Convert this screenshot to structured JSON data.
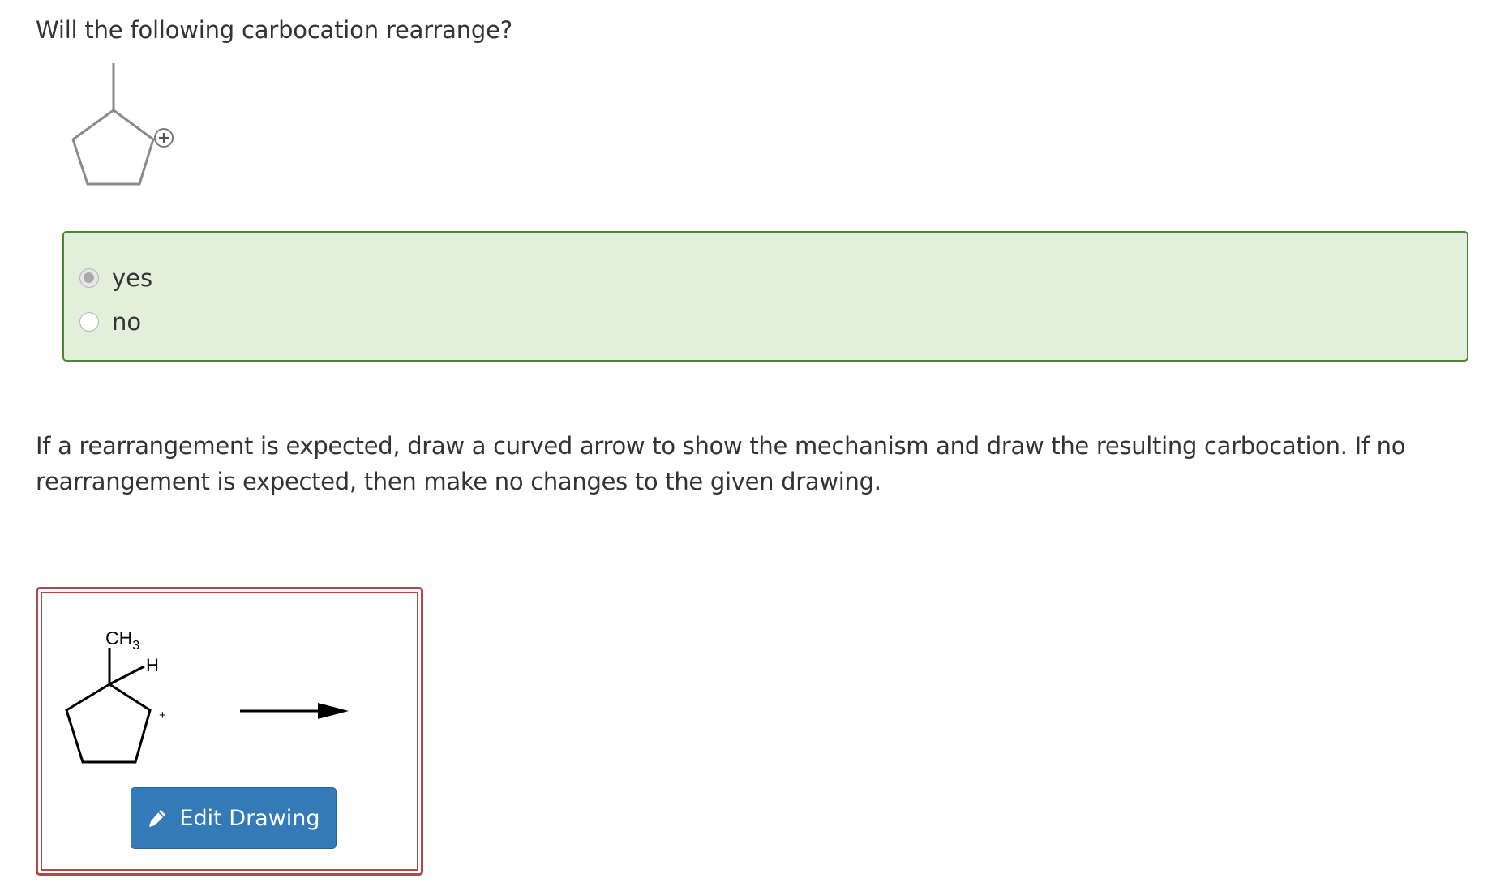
{
  "question": {
    "text": "Will the following carbocation rearrange?"
  },
  "molecule": {
    "charge_symbol": "+"
  },
  "choices": {
    "options": [
      {
        "label": "yes",
        "selected": true
      },
      {
        "label": "no",
        "selected": false
      }
    ],
    "correct_color": "#e2efdb",
    "correct_border": "#4c8533"
  },
  "instructions": {
    "text": "If a rearrangement is expected, draw a curved arrow to show the mechanism and draw the resulting carbocation. If no rearrangement is expected, then make no changes to the given drawing."
  },
  "drawing": {
    "methyl_label": "CH3",
    "methyl_main": "CH",
    "methyl_subscript": "3",
    "hydrogen_label": "H",
    "charge_symbol": "+",
    "border_color": "#b04a4a",
    "edit_button": {
      "label": "Edit Drawing",
      "icon": "pencil-icon",
      "color": "#337ab7"
    }
  }
}
